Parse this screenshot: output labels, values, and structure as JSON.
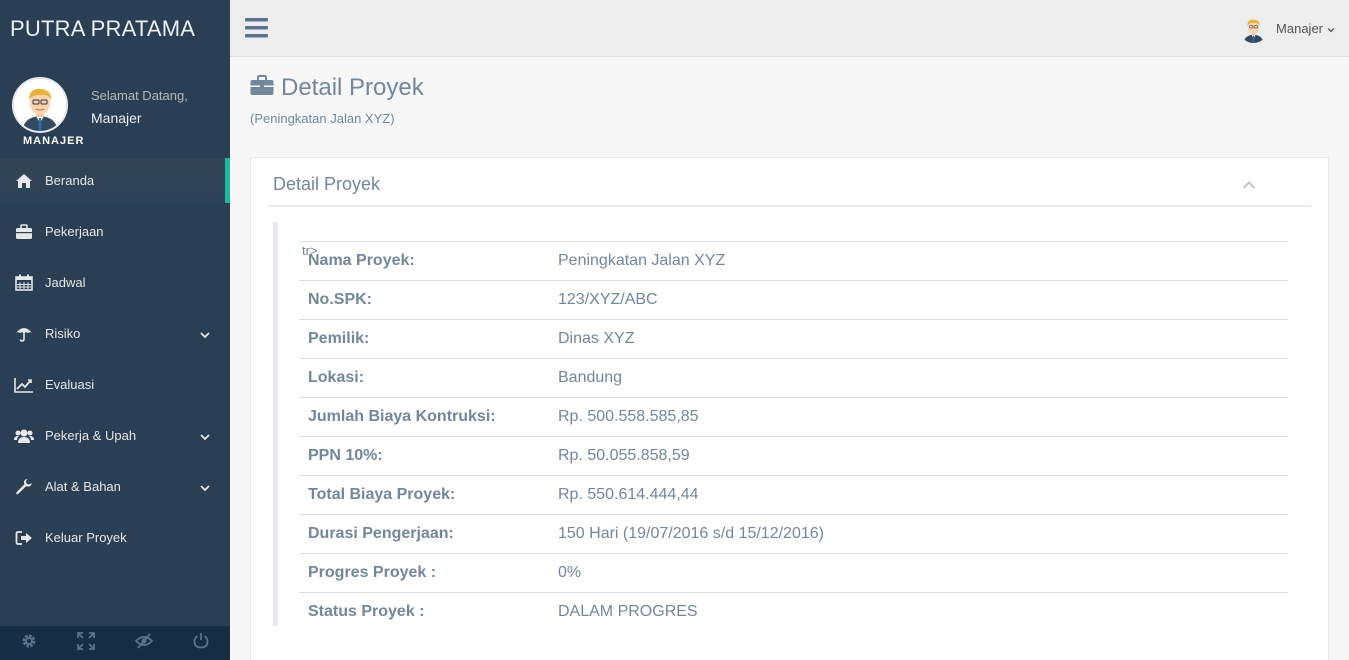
{
  "brand": "PUTRA PRATAMA",
  "profile": {
    "welcome": "Selamat Datang,",
    "name": "Manajer",
    "role_tag": "MANAJER"
  },
  "menu": [
    {
      "label": "Beranda",
      "icon": "home-icon",
      "active": true
    },
    {
      "label": "Pekerjaan",
      "icon": "briefcase-icon"
    },
    {
      "label": "Jadwal",
      "icon": "calendar-icon"
    },
    {
      "label": "Risiko",
      "icon": "umbrella-icon",
      "has_submenu": true
    },
    {
      "label": "Evaluasi",
      "icon": "line-chart-icon"
    },
    {
      "label": "Pekerja & Upah",
      "icon": "users-icon",
      "has_submenu": true
    },
    {
      "label": "Alat & Bahan",
      "icon": "wrench-icon",
      "has_submenu": true
    },
    {
      "label": "Keluar Proyek",
      "icon": "sign-out-icon"
    }
  ],
  "footer_icons": [
    "settings-icon",
    "fullscreen-icon",
    "eye-slash-icon",
    "power-icon"
  ],
  "topnav": {
    "user": "Manajer"
  },
  "page": {
    "title": "Detail Proyek",
    "subtitle": "(Peningkatan Jalan XYZ)"
  },
  "panel": {
    "title": "Detail Proyek",
    "stray_text": "tr>",
    "rows": [
      {
        "label": "Nama Proyek:",
        "value": "Peningkatan Jalan XYZ"
      },
      {
        "label": "No.SPK:",
        "value": "123/XYZ/ABC"
      },
      {
        "label": "Pemilik:",
        "value": "Dinas XYZ"
      },
      {
        "label": "Lokasi:",
        "value": "Bandung"
      },
      {
        "label": "Jumlah Biaya Kontruksi:",
        "value": "Rp. 500.558.585,85"
      },
      {
        "label": "PPN 10%:",
        "value": "Rp. 50.055.858,59"
      },
      {
        "label": "Total Biaya Proyek:",
        "value": "Rp. 550.614.444,44"
      },
      {
        "label": "Durasi Pengerjaan:",
        "value": "150 Hari (19/07/2016 s/d 15/12/2016)"
      },
      {
        "label": "Progres Proyek :",
        "value": "0%"
      },
      {
        "label": "Status Proyek :",
        "value": "DALAM PROGRES"
      }
    ]
  },
  "colors": {
    "sidebar_bg": "#2A3F54",
    "accent": "#1ABB9C",
    "text": "#73879C",
    "topnav_bg": "#EDEDED"
  }
}
